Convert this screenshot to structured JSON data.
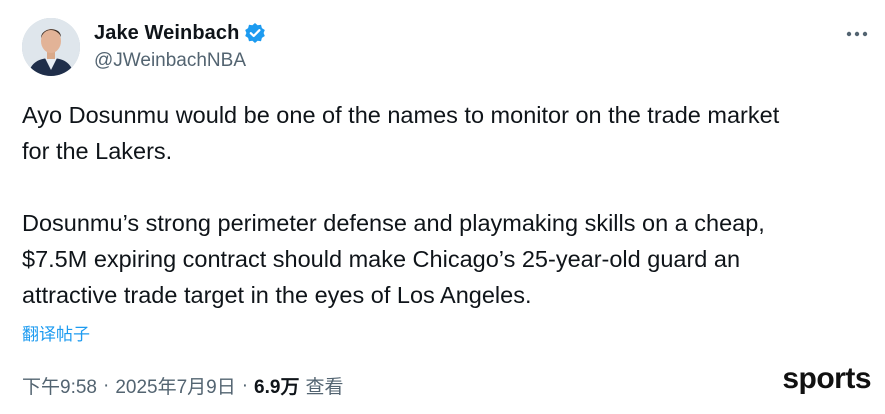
{
  "author": {
    "display_name": "Jake Weinbach",
    "handle": "@JWeinbachNBA",
    "verified": true,
    "verified_color": "#1d9bf0"
  },
  "tweet": {
    "paragraphs": [
      "Ayo Dosunmu would be one of the names to monitor on the trade market\nfor the Lakers.",
      "Dosunmu’s strong perimeter defense and playmaking skills on a cheap,\n$7.5M expiring contract should make Chicago’s 25-year-old guard an\nattractive trade target in the eyes of Los Angeles."
    ],
    "translate_label": "翻译帖子"
  },
  "meta": {
    "time": "下午9:58",
    "separator": "·",
    "date": "2025年7月9日",
    "views_count": "6.9万",
    "views_label": "查看"
  },
  "watermark": "sports",
  "icons": {
    "more": "more-horizontal-icon",
    "verified": "verified-badge-icon"
  }
}
